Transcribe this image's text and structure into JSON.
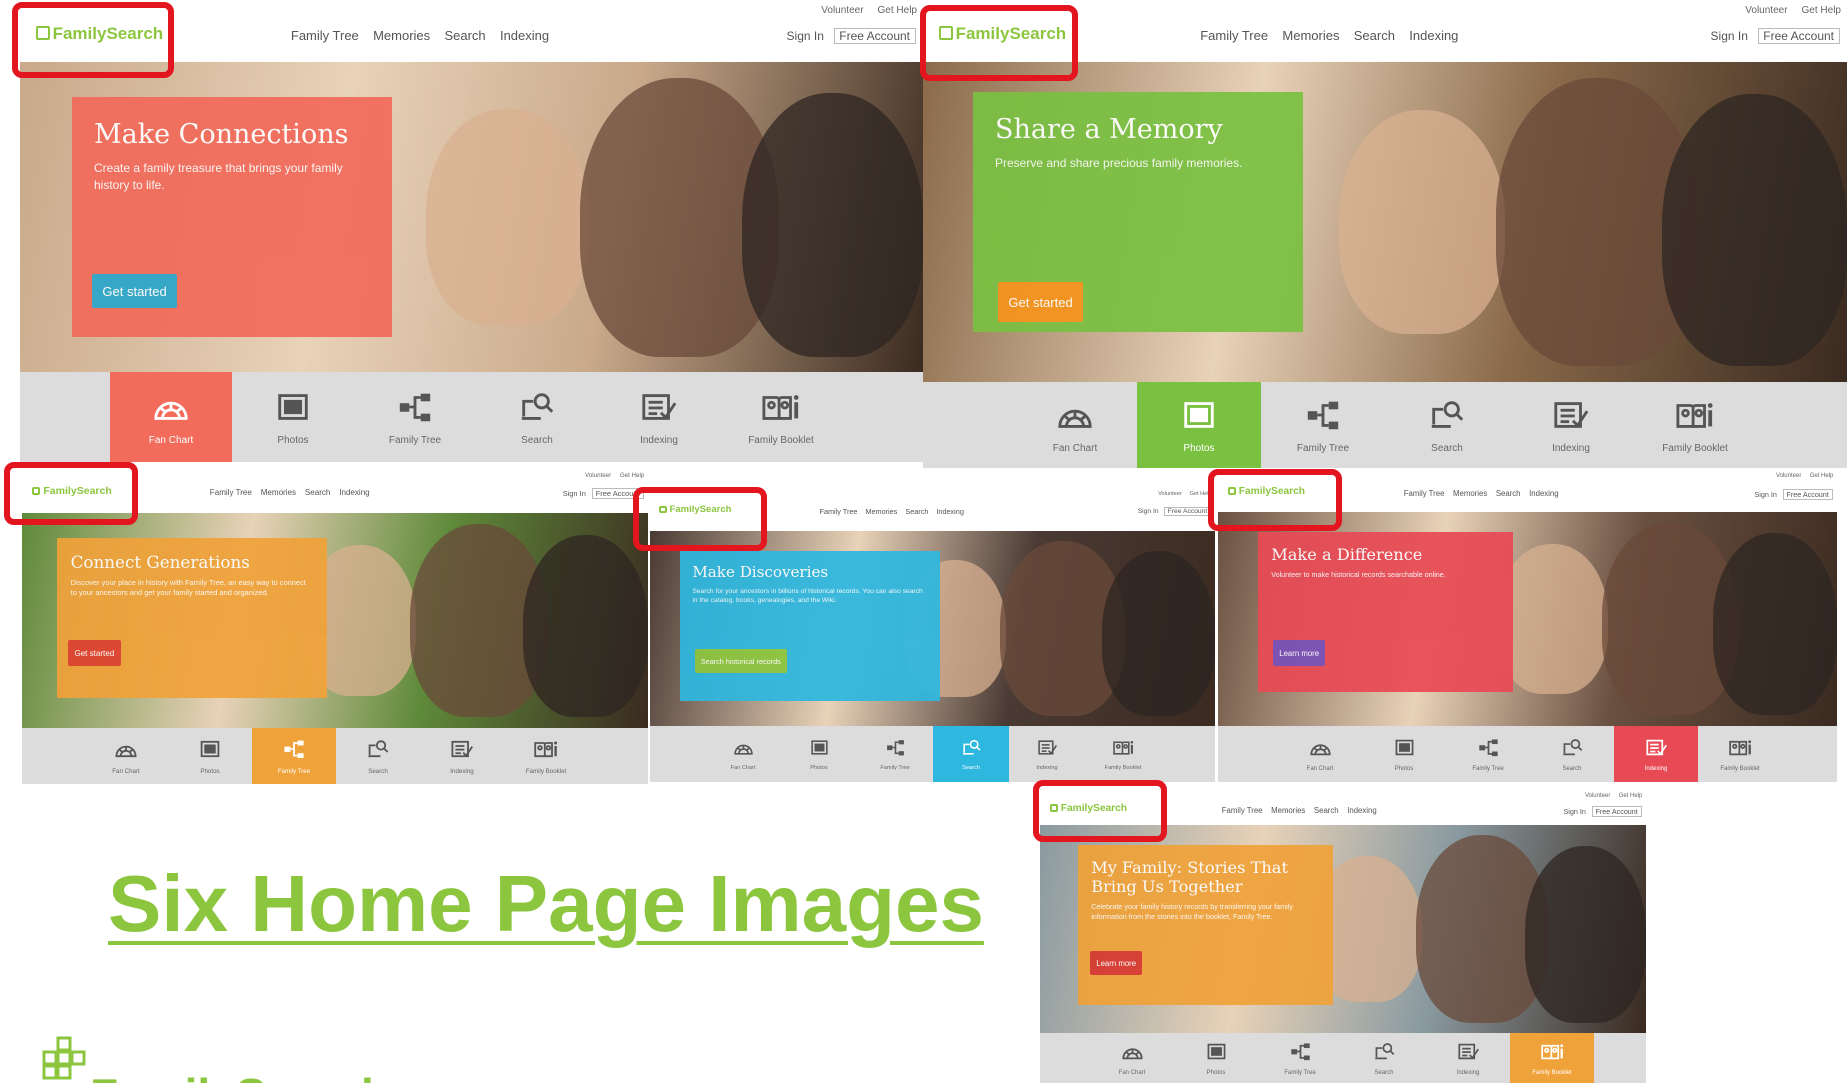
{
  "title": "Six Home Page Images",
  "brand": "FamilySearch",
  "colors": {
    "brand": "#8cc63f",
    "highlight": "#e3161f",
    "tile_bar": "#dcdcdc",
    "tile_icon": "#555555"
  },
  "site": {
    "logo": "FamilySearch",
    "nav": [
      "Family Tree",
      "Memories",
      "Search",
      "Indexing"
    ],
    "top_links": [
      "Volunteer",
      "Get Help"
    ],
    "sign_in": "Sign In",
    "free_account": "Free Account"
  },
  "tiles": [
    {
      "label": "Fan Chart",
      "icon": "fan-chart-icon"
    },
    {
      "label": "Photos",
      "icon": "photos-icon"
    },
    {
      "label": "Family Tree",
      "icon": "family-tree-icon"
    },
    {
      "label": "Search",
      "icon": "search-icon"
    },
    {
      "label": "Indexing",
      "icon": "indexing-icon"
    },
    {
      "label": "Family Booklet",
      "icon": "family-booklet-icon"
    }
  ],
  "shots": [
    {
      "heading": "Make Connections",
      "description": "Create a family treasure that brings your family history to life.",
      "button": "Get started",
      "panel_color": "#f26b5b",
      "button_color": "#2ba6cb",
      "active_tile": 0
    },
    {
      "heading": "Share a Memory",
      "description": "Preserve and share precious family memories.",
      "button": "Get started",
      "panel_color": "#7ac142",
      "button_color": "#f7941d",
      "active_tile": 1
    },
    {
      "heading": "Connect Generations",
      "description": "Discover your place in history with Family Tree, an easy way to connect to your ancestors and get your family started and organized.",
      "button": "Get started",
      "panel_color": "#f0a23a",
      "button_color": "#e2412f",
      "active_tile": 2
    },
    {
      "heading": "Make Discoveries",
      "description": "Search for your ancestors in billions of historical records. You can also search in the catalog, books, genealogies, and the Wiki.",
      "button": "Search historical records",
      "panel_color": "#2eb8e0",
      "button_color": "#8cc63f",
      "active_tile": 3
    },
    {
      "heading": "Make a Difference",
      "description": "Volunteer to make historical records searchable online.",
      "button": "Learn more",
      "panel_color": "#e84a55",
      "button_color": "#7a4fb8",
      "active_tile": 4
    },
    {
      "heading": "My Family: Stories That Bring Us Together",
      "description": "Celebrate your family history records by transferring your family information from the stories into the booklet, Family Tree.",
      "button": "Learn more",
      "panel_color": "#f0a23a",
      "button_color": "#d9382e",
      "active_tile": 5
    }
  ]
}
